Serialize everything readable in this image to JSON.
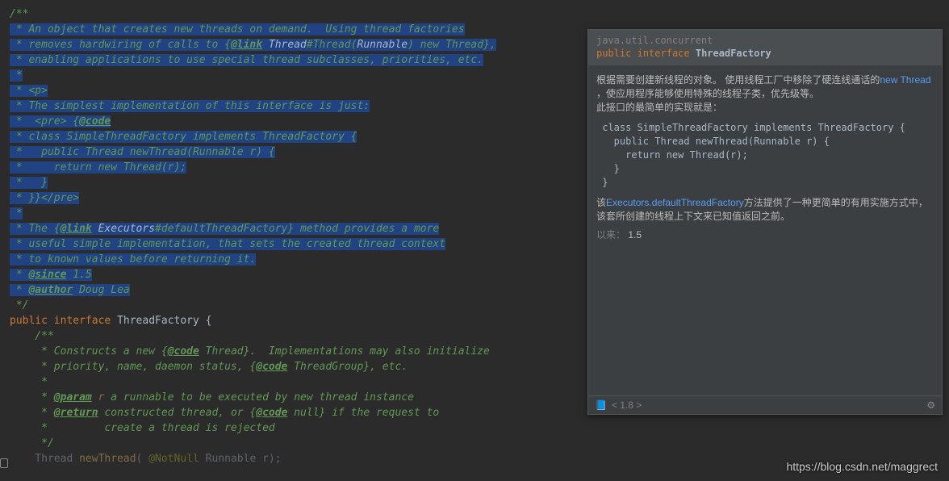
{
  "code": {
    "l1": "/**",
    "l2a": " * ",
    "l2b": "An object that creates new threads on demand.  Using thread factories",
    "l3a": " * removes hardwiring of calls to {",
    "l3link": "@link",
    "l3b": " Thread",
    "l3c": "#Thread(",
    "l3d": "Runnable",
    "l3e": ") new Thread},",
    "l4": " * enabling applications to use special thread subclasses, priorities, etc.",
    "l5": " *",
    "l6": " * <p>",
    "l7": " * The simplest implementation of this interface is just:",
    "l8a": " *  <pre> {",
    "l8code": "@code",
    "l9": " * class SimpleThreadFactory implements ThreadFactory {",
    "l10": " *   public Thread newThread(Runnable r) {",
    "l11": " *     return new Thread(r);",
    "l12": " *   }",
    "l13": " * }}</pre>",
    "l14": " *",
    "l15a": " * The {",
    "l15link": "@link",
    "l15b": " Executors",
    "l15c": "#defaultThreadFactory} method provides a more",
    "l16": " * useful simple implementation, that sets the created thread context",
    "l17": " * to known values before returning it.",
    "l18a": " * ",
    "l18tag": "@since",
    "l18b": " 1.5",
    "l19a": " * ",
    "l19tag": "@author",
    "l19b": " Doug Lea",
    "l20": " */",
    "l21a": "public",
    "l21b": " interface",
    "l21c": " ThreadFactory {",
    "l22": "",
    "l23": "    /**",
    "l24a": "     * Constructs a new {",
    "l24code": "@code",
    "l24b": " Thread}.  Implementations may also initialize",
    "l25a": "     * priority, name, daemon status, {",
    "l25code": "@code",
    "l25b": " ThreadGroup}, etc.",
    "l26": "     *",
    "l27a": "     * ",
    "l27tag": "@param",
    "l27p": " r",
    "l27b": " a runnable to be executed by new thread instance",
    "l28a": "     * ",
    "l28tag": "@return",
    "l28b": " constructed thread, or {",
    "l28code": "@code",
    "l28c": " null} if the request to",
    "l29": "     *         create a thread is rejected",
    "l30": "     */",
    "l31a": "    Thread ",
    "l31m": "newThread",
    "l31b": "( ",
    "l31ann": "@NotNull",
    "l31c": " Runnable r);"
  },
  "doc": {
    "pkg": "java.util.concurrent",
    "sig_kw1": "public",
    "sig_kw2": "interface",
    "sig_name": "ThreadFactory",
    "p1a": "根据需要创建新线程的对象。 使用线程工厂中移除了硬连线通话的",
    "p1link": "new Thread",
    "p1b": " ，使应用程序能够使用特殊的线程子类，优先级等。",
    "p2": "此接口的最简单的实现就是：",
    "codeblock": " class SimpleThreadFactory implements ThreadFactory {\n   public Thread newThread(Runnable r) {\n     return new Thread(r);\n   }\n }",
    "p3a": "该",
    "p3link": "Executors.defaultThreadFactory",
    "p3b": "方法提供了一种更简单的有用实施方式中，该套所创建的线程上下文来已知值返回之前。",
    "since_label": "以来：",
    "since_val": "1.5",
    "footer": "< 1.8 >"
  },
  "watermark": "https://blog.csdn.net/maggrect"
}
